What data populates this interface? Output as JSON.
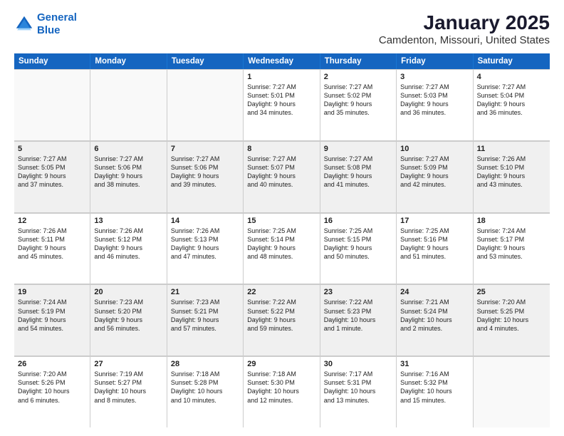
{
  "logo": {
    "line1": "General",
    "line2": "Blue"
  },
  "title": "January 2025",
  "subtitle": "Camdenton, Missouri, United States",
  "header_days": [
    "Sunday",
    "Monday",
    "Tuesday",
    "Wednesday",
    "Thursday",
    "Friday",
    "Saturday"
  ],
  "weeks": [
    [
      {
        "day": "",
        "empty": true
      },
      {
        "day": "",
        "empty": true
      },
      {
        "day": "",
        "empty": true
      },
      {
        "day": "1",
        "lines": [
          "Sunrise: 7:27 AM",
          "Sunset: 5:01 PM",
          "Daylight: 9 hours",
          "and 34 minutes."
        ]
      },
      {
        "day": "2",
        "lines": [
          "Sunrise: 7:27 AM",
          "Sunset: 5:02 PM",
          "Daylight: 9 hours",
          "and 35 minutes."
        ]
      },
      {
        "day": "3",
        "lines": [
          "Sunrise: 7:27 AM",
          "Sunset: 5:03 PM",
          "Daylight: 9 hours",
          "and 36 minutes."
        ]
      },
      {
        "day": "4",
        "lines": [
          "Sunrise: 7:27 AM",
          "Sunset: 5:04 PM",
          "Daylight: 9 hours",
          "and 36 minutes."
        ]
      }
    ],
    [
      {
        "day": "5",
        "lines": [
          "Sunrise: 7:27 AM",
          "Sunset: 5:05 PM",
          "Daylight: 9 hours",
          "and 37 minutes."
        ]
      },
      {
        "day": "6",
        "lines": [
          "Sunrise: 7:27 AM",
          "Sunset: 5:06 PM",
          "Daylight: 9 hours",
          "and 38 minutes."
        ]
      },
      {
        "day": "7",
        "lines": [
          "Sunrise: 7:27 AM",
          "Sunset: 5:06 PM",
          "Daylight: 9 hours",
          "and 39 minutes."
        ]
      },
      {
        "day": "8",
        "lines": [
          "Sunrise: 7:27 AM",
          "Sunset: 5:07 PM",
          "Daylight: 9 hours",
          "and 40 minutes."
        ]
      },
      {
        "day": "9",
        "lines": [
          "Sunrise: 7:27 AM",
          "Sunset: 5:08 PM",
          "Daylight: 9 hours",
          "and 41 minutes."
        ]
      },
      {
        "day": "10",
        "lines": [
          "Sunrise: 7:27 AM",
          "Sunset: 5:09 PM",
          "Daylight: 9 hours",
          "and 42 minutes."
        ]
      },
      {
        "day": "11",
        "lines": [
          "Sunrise: 7:26 AM",
          "Sunset: 5:10 PM",
          "Daylight: 9 hours",
          "and 43 minutes."
        ]
      }
    ],
    [
      {
        "day": "12",
        "lines": [
          "Sunrise: 7:26 AM",
          "Sunset: 5:11 PM",
          "Daylight: 9 hours",
          "and 45 minutes."
        ]
      },
      {
        "day": "13",
        "lines": [
          "Sunrise: 7:26 AM",
          "Sunset: 5:12 PM",
          "Daylight: 9 hours",
          "and 46 minutes."
        ]
      },
      {
        "day": "14",
        "lines": [
          "Sunrise: 7:26 AM",
          "Sunset: 5:13 PM",
          "Daylight: 9 hours",
          "and 47 minutes."
        ]
      },
      {
        "day": "15",
        "lines": [
          "Sunrise: 7:25 AM",
          "Sunset: 5:14 PM",
          "Daylight: 9 hours",
          "and 48 minutes."
        ]
      },
      {
        "day": "16",
        "lines": [
          "Sunrise: 7:25 AM",
          "Sunset: 5:15 PM",
          "Daylight: 9 hours",
          "and 50 minutes."
        ]
      },
      {
        "day": "17",
        "lines": [
          "Sunrise: 7:25 AM",
          "Sunset: 5:16 PM",
          "Daylight: 9 hours",
          "and 51 minutes."
        ]
      },
      {
        "day": "18",
        "lines": [
          "Sunrise: 7:24 AM",
          "Sunset: 5:17 PM",
          "Daylight: 9 hours",
          "and 53 minutes."
        ]
      }
    ],
    [
      {
        "day": "19",
        "lines": [
          "Sunrise: 7:24 AM",
          "Sunset: 5:19 PM",
          "Daylight: 9 hours",
          "and 54 minutes."
        ]
      },
      {
        "day": "20",
        "lines": [
          "Sunrise: 7:23 AM",
          "Sunset: 5:20 PM",
          "Daylight: 9 hours",
          "and 56 minutes."
        ]
      },
      {
        "day": "21",
        "lines": [
          "Sunrise: 7:23 AM",
          "Sunset: 5:21 PM",
          "Daylight: 9 hours",
          "and 57 minutes."
        ]
      },
      {
        "day": "22",
        "lines": [
          "Sunrise: 7:22 AM",
          "Sunset: 5:22 PM",
          "Daylight: 9 hours",
          "and 59 minutes."
        ]
      },
      {
        "day": "23",
        "lines": [
          "Sunrise: 7:22 AM",
          "Sunset: 5:23 PM",
          "Daylight: 10 hours",
          "and 1 minute."
        ]
      },
      {
        "day": "24",
        "lines": [
          "Sunrise: 7:21 AM",
          "Sunset: 5:24 PM",
          "Daylight: 10 hours",
          "and 2 minutes."
        ]
      },
      {
        "day": "25",
        "lines": [
          "Sunrise: 7:20 AM",
          "Sunset: 5:25 PM",
          "Daylight: 10 hours",
          "and 4 minutes."
        ]
      }
    ],
    [
      {
        "day": "26",
        "lines": [
          "Sunrise: 7:20 AM",
          "Sunset: 5:26 PM",
          "Daylight: 10 hours",
          "and 6 minutes."
        ]
      },
      {
        "day": "27",
        "lines": [
          "Sunrise: 7:19 AM",
          "Sunset: 5:27 PM",
          "Daylight: 10 hours",
          "and 8 minutes."
        ]
      },
      {
        "day": "28",
        "lines": [
          "Sunrise: 7:18 AM",
          "Sunset: 5:28 PM",
          "Daylight: 10 hours",
          "and 10 minutes."
        ]
      },
      {
        "day": "29",
        "lines": [
          "Sunrise: 7:18 AM",
          "Sunset: 5:30 PM",
          "Daylight: 10 hours",
          "and 12 minutes."
        ]
      },
      {
        "day": "30",
        "lines": [
          "Sunrise: 7:17 AM",
          "Sunset: 5:31 PM",
          "Daylight: 10 hours",
          "and 13 minutes."
        ]
      },
      {
        "day": "31",
        "lines": [
          "Sunrise: 7:16 AM",
          "Sunset: 5:32 PM",
          "Daylight: 10 hours",
          "and 15 minutes."
        ]
      },
      {
        "day": "",
        "empty": true
      }
    ]
  ],
  "colors": {
    "header_bg": "#1565c0",
    "shaded_row": "#f0f0f0",
    "empty_cell": "#f9f9f9"
  }
}
